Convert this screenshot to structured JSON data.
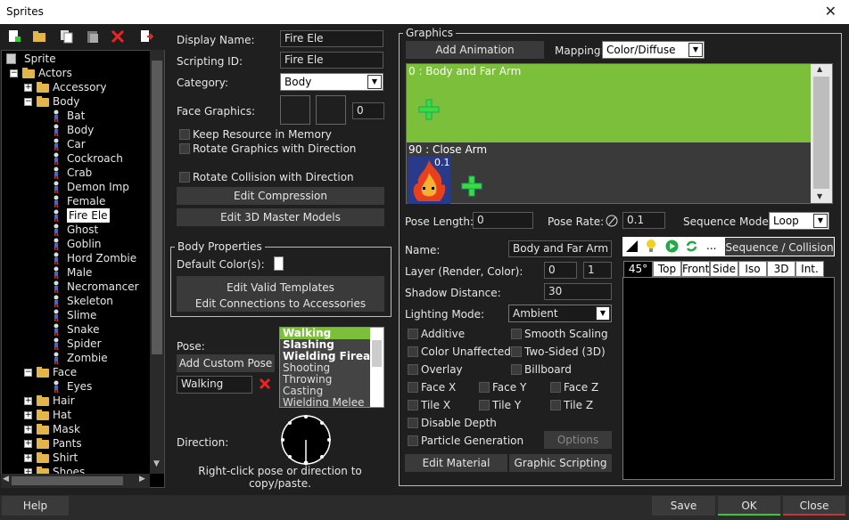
{
  "window": {
    "title": "Sprites",
    "close_glyph": "✕"
  },
  "tree": {
    "items": [
      {
        "label": "Sprite",
        "depth": 0,
        "kind": "root",
        "exp": ""
      },
      {
        "label": "Actors",
        "depth": 1,
        "kind": "folder",
        "exp": "-"
      },
      {
        "label": "Accessory",
        "depth": 2,
        "kind": "folder",
        "exp": "+"
      },
      {
        "label": "Body",
        "depth": 2,
        "kind": "folder",
        "exp": "-"
      },
      {
        "label": "Bat",
        "depth": 3,
        "kind": "actor",
        "exp": ""
      },
      {
        "label": "Body",
        "depth": 3,
        "kind": "actor",
        "exp": ""
      },
      {
        "label": "Car",
        "depth": 3,
        "kind": "actor",
        "exp": ""
      },
      {
        "label": "Cockroach",
        "depth": 3,
        "kind": "actor",
        "exp": ""
      },
      {
        "label": "Crab",
        "depth": 3,
        "kind": "actor",
        "exp": ""
      },
      {
        "label": "Demon Imp",
        "depth": 3,
        "kind": "actor",
        "exp": ""
      },
      {
        "label": "Female",
        "depth": 3,
        "kind": "actor",
        "exp": ""
      },
      {
        "label": "Fire Ele",
        "depth": 3,
        "kind": "actor",
        "exp": "",
        "selected": true
      },
      {
        "label": "Ghost",
        "depth": 3,
        "kind": "actor",
        "exp": ""
      },
      {
        "label": "Goblin",
        "depth": 3,
        "kind": "actor",
        "exp": ""
      },
      {
        "label": "Hord Zombie",
        "depth": 3,
        "kind": "actor",
        "exp": ""
      },
      {
        "label": "Male",
        "depth": 3,
        "kind": "actor",
        "exp": ""
      },
      {
        "label": "Necromancer",
        "depth": 3,
        "kind": "actor",
        "exp": ""
      },
      {
        "label": "Skeleton",
        "depth": 3,
        "kind": "actor",
        "exp": ""
      },
      {
        "label": "Slime",
        "depth": 3,
        "kind": "actor",
        "exp": ""
      },
      {
        "label": "Snake",
        "depth": 3,
        "kind": "actor",
        "exp": ""
      },
      {
        "label": "Spider",
        "depth": 3,
        "kind": "actor",
        "exp": ""
      },
      {
        "label": "Zombie",
        "depth": 3,
        "kind": "actor",
        "exp": ""
      },
      {
        "label": "Face",
        "depth": 2,
        "kind": "folder",
        "exp": "-"
      },
      {
        "label": "Eyes",
        "depth": 3,
        "kind": "actor",
        "exp": ""
      },
      {
        "label": "Hair",
        "depth": 2,
        "kind": "folder",
        "exp": "+"
      },
      {
        "label": "Hat",
        "depth": 2,
        "kind": "folder",
        "exp": "+"
      },
      {
        "label": "Mask",
        "depth": 2,
        "kind": "folder",
        "exp": "+"
      },
      {
        "label": "Pants",
        "depth": 2,
        "kind": "folder",
        "exp": "+"
      },
      {
        "label": "Shirt",
        "depth": 2,
        "kind": "folder",
        "exp": "+"
      },
      {
        "label": "Shoes",
        "depth": 2,
        "kind": "folder",
        "exp": "+"
      }
    ]
  },
  "props": {
    "display_name_label": "Display Name:",
    "display_name": "Fire Ele",
    "scripting_id_label": "Scripting ID:",
    "scripting_id": "Fire Ele",
    "category_label": "Category:",
    "category": "Body",
    "face_graphics_label": "Face Graphics:",
    "face_value": "0",
    "keep_resource": "Keep Resource in Memory",
    "rotate_graphics": "Rotate Graphics with Direction",
    "rotate_collision": "Rotate Collision with Direction",
    "edit_compression": "Edit Compression",
    "edit_3d": "Edit 3D Master Models"
  },
  "body_props": {
    "title": "Body Properties",
    "default_colors": "Default Color(s):",
    "edit_templates": "Edit Valid Templates",
    "edit_connections": "Edit Connections to Accessories"
  },
  "pose": {
    "label": "Pose:",
    "add_custom": "Add Custom Pose",
    "current": "Walking",
    "list": [
      "Walking",
      "Slashing",
      "Wielding Firearm",
      "Shooting",
      "Throwing",
      "Casting",
      "Wielding Melee"
    ]
  },
  "direction": {
    "label": "Direction:",
    "hint": "Right-click pose or direction to copy/paste."
  },
  "graphics": {
    "title": "Graphics",
    "add_animation": "Add Animation",
    "mapping_label": "Mapping:",
    "mapping": "Color/Diffuse",
    "layer0": "0 : Body and Far Arm",
    "layer1": "90 : Close Arm",
    "layer1_frame": "0.1",
    "pose_length_label": "Pose Length:",
    "pose_length": "0",
    "pose_rate_label": "Pose Rate:",
    "pose_rate": "0.1",
    "sequence_mode_label": "Sequence Mode:",
    "sequence_mode": "Loop",
    "name_label": "Name:",
    "name": "Body and Far Arm",
    "layer_label": "Layer (Render, Color):",
    "layer_render": "0",
    "layer_color": "1",
    "shadow_label": "Shadow Distance:",
    "shadow": "30",
    "lighting_label": "Lighting Mode:",
    "lighting": "Ambient",
    "additive": "Additive",
    "smooth_scaling": "Smooth Scaling",
    "color_unaffected": "Color Unaffected",
    "two_sided": "Two-Sided (3D)",
    "overlay": "Overlay",
    "billboard": "Billboard",
    "face_x": "Face X",
    "face_y": "Face Y",
    "face_z": "Face Z",
    "tile_x": "Tile X",
    "tile_y": "Tile Y",
    "tile_z": "Tile Z",
    "disable_depth": "Disable Depth",
    "particle": "Particle Generation",
    "options": "Options",
    "edit_material": "Edit Material",
    "graphic_scripting": "Graphic Scripting",
    "seq_collision": "Sequence / Collision",
    "dots": "...",
    "tabs": [
      "45°",
      "Top",
      "Front",
      "Side",
      "Iso",
      "3D",
      "Int."
    ]
  },
  "footer": {
    "help": "Help",
    "save": "Save",
    "ok": "OK",
    "close": "Close"
  },
  "colors": {
    "green": "#7cbf3a",
    "plus": "#3ddc3d",
    "accent": "#e0e0e0"
  }
}
